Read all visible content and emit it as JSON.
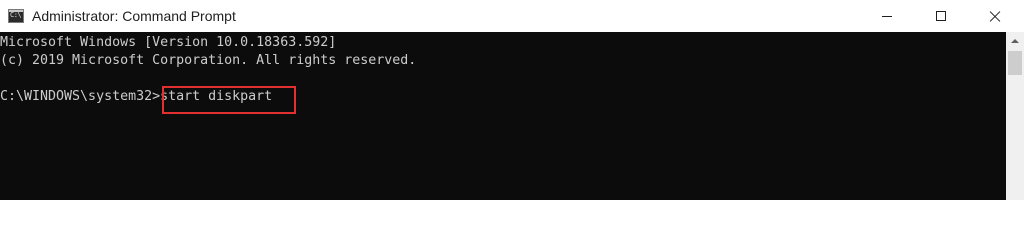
{
  "window": {
    "title": "Administrator: Command Prompt",
    "icon": "cmd-icon",
    "icon_text": "C:\\",
    "controls": {
      "minimize": "minimize-icon",
      "maximize": "maximize-icon",
      "close": "close-icon"
    }
  },
  "console": {
    "lines": [
      "Microsoft Windows [Version 10.0.18363.592]",
      "(c) 2019 Microsoft Corporation. All rights reserved."
    ],
    "prompt": "C:\\WINDOWS\\system32>",
    "command": "start diskpart",
    "colors": {
      "background": "#0c0c0c",
      "text": "#cccccc",
      "highlight": "#e03030"
    }
  }
}
